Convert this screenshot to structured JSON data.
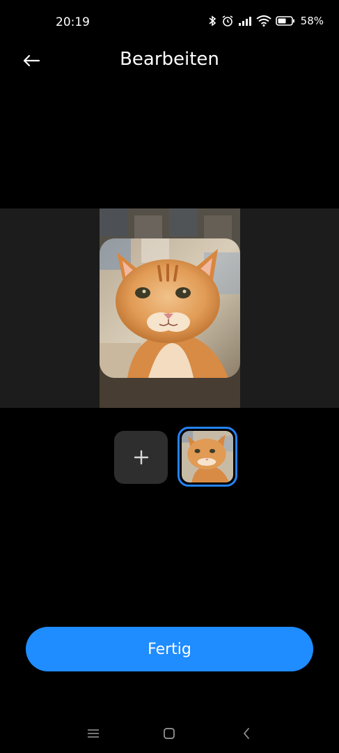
{
  "status_bar": {
    "time": "20:19",
    "battery_percent": "58%",
    "icons": [
      "bluetooth-icon",
      "alarm-icon",
      "signal-icon",
      "wifi-icon",
      "battery-icon"
    ]
  },
  "header": {
    "title": "Bearbeiten",
    "back_icon": "arrow-left-icon"
  },
  "image_strip": {
    "add_label": "+"
  },
  "actions": {
    "done_label": "Fertig"
  },
  "nav": {
    "icons": [
      "menu-icon",
      "home-icon",
      "back-chevron-icon"
    ]
  },
  "colors": {
    "accent": "#1f8cff",
    "background": "#000000"
  }
}
